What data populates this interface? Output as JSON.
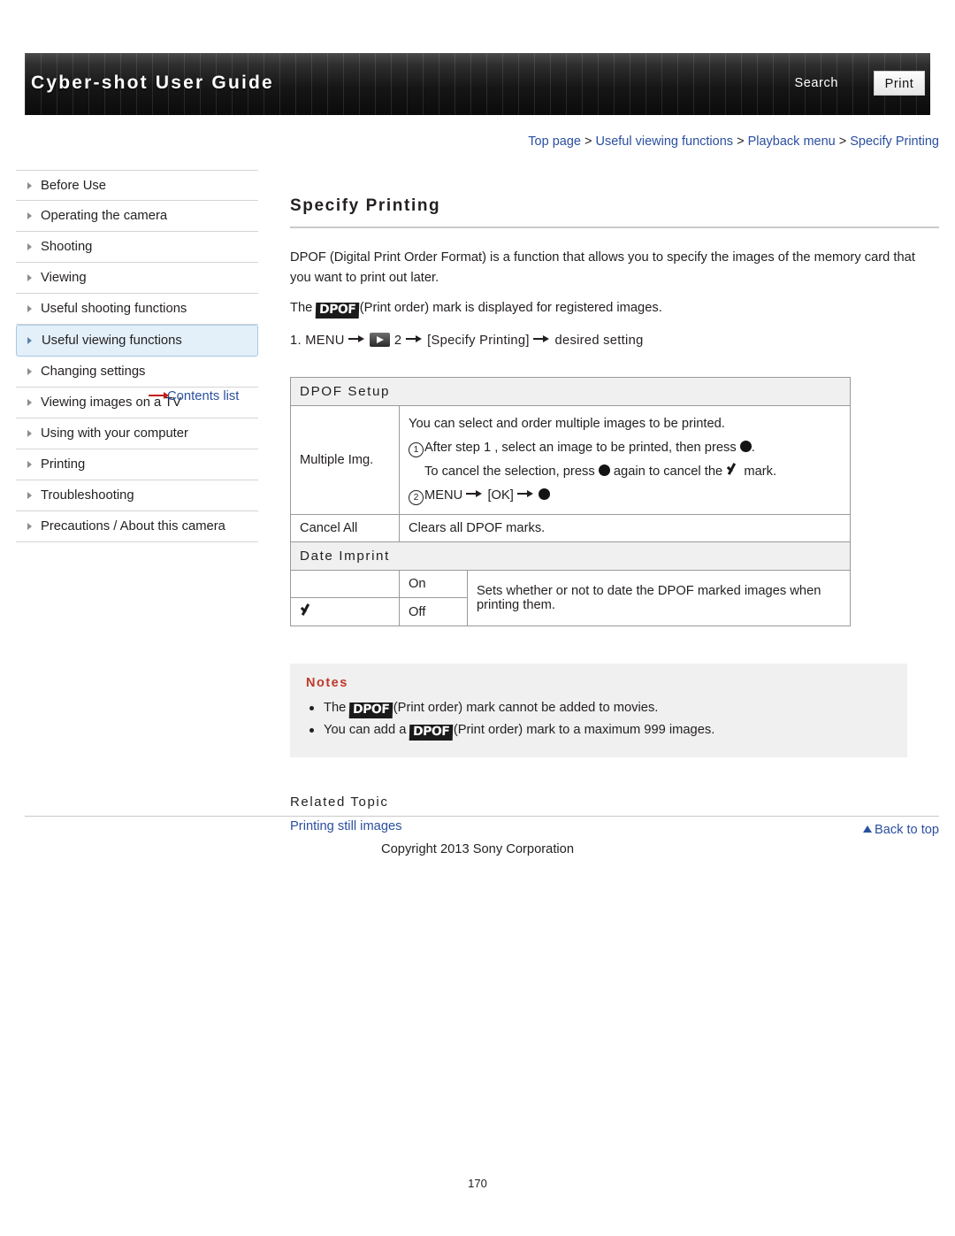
{
  "header": {
    "title": "Cyber-shot User Guide",
    "search_label": "Search",
    "print_label": "Print"
  },
  "breadcrumb": {
    "item1": "Top page",
    "item2": "Useful viewing functions",
    "item3": "Playback menu",
    "item4": "Specify Printing",
    "separator": ">"
  },
  "sidebar": {
    "items": [
      {
        "label": "Before Use"
      },
      {
        "label": "Operating the camera"
      },
      {
        "label": "Shooting"
      },
      {
        "label": "Viewing"
      },
      {
        "label": "Useful shooting functions"
      },
      {
        "label": "Useful viewing functions"
      },
      {
        "label": "Changing settings"
      },
      {
        "label": "Viewing images on a TV"
      },
      {
        "label": "Using with your computer"
      },
      {
        "label": "Printing"
      },
      {
        "label": "Troubleshooting"
      },
      {
        "label": "Precautions / About this camera"
      }
    ],
    "contents_list": "Contents list"
  },
  "main": {
    "title": "Specify Printing",
    "paragraph1": "DPOF (Digital Print Order Format) is a function that allows you to specify the images of the memory card that you want to print out later.",
    "paragraph2_pre": "The",
    "paragraph2_post": "(Print order) mark is displayed for registered images.",
    "dpof_logo": "DPOF",
    "step": {
      "number": "1.",
      "menu": "MENU",
      "screen_number": "2",
      "bracket": "[Specify Printing]",
      "tail": "desired setting"
    },
    "table": {
      "section1": "DPOF Setup",
      "section2": "Date Imprint",
      "rows": [
        {
          "label": "Multiple Img.",
          "line1": "You can select and order multiple images to be printed.",
          "line2_num": "1",
          "line2": "After step 1 , select an image to be printed, then press",
          "line2_end": ".",
          "line3": "To cancel the selection, press",
          "line3_mid": "again to cancel the",
          "line3_end": "mark.",
          "line4_num": "2",
          "line4_menu": "MENU",
          "line4_ok": "[OK]"
        },
        {
          "label": "Cancel All",
          "desc": "Clears all DPOF marks."
        }
      ],
      "date_rows": [
        {
          "check": "",
          "label": "On"
        },
        {
          "check": "checked",
          "label": "Off"
        }
      ],
      "date_desc": "Sets whether or not to date the DPOF marked images when printing them."
    },
    "notes": {
      "title": "Notes",
      "note1_pre": "The",
      "note1_post": "(Print order) mark cannot be added to movies.",
      "note2_pre": "You can add a",
      "note2_post": "(Print order) mark to a maximum 999 images."
    },
    "related": {
      "heading": "Related Topic",
      "link": "Printing still images"
    }
  },
  "footer": {
    "back_to_top": "Back to top",
    "copyright": "Copyright 2013 Sony Corporation",
    "page_number": "170"
  }
}
